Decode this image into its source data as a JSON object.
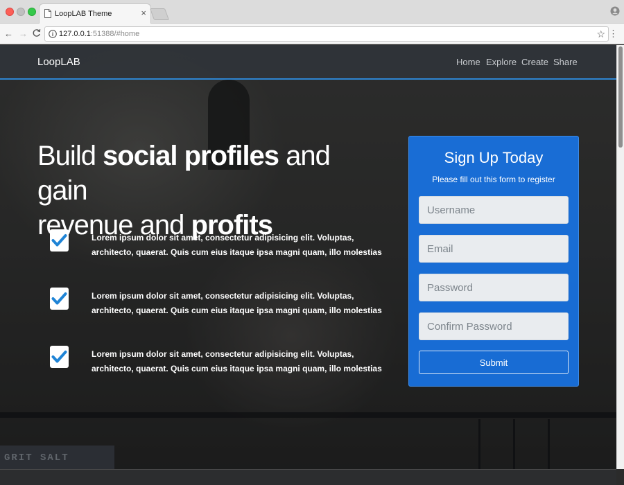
{
  "browser": {
    "tab_title": "LoopLAB Theme",
    "tab_close": "×",
    "url_host": "127.0.0.1",
    "url_rest": ":51388/#home",
    "back": "←",
    "forward": "→",
    "reload": "C",
    "star": "☆",
    "menu": "⋮",
    "icons": [
      "page-icon",
      "info-icon",
      "profile-icon",
      "star-icon",
      "menu-icon"
    ]
  },
  "navbar": {
    "brand": "LoopLAB",
    "links": [
      "Home",
      "Explore",
      "Create",
      "Share"
    ],
    "accent_color": "#2e86d3"
  },
  "hero": {
    "title_parts": [
      "Build ",
      "social profiles",
      " and gain ",
      "revenue and ",
      "profits"
    ]
  },
  "features": [
    {
      "text": "Lorem ipsum dolor sit amet, consectetur adipisicing elit. Voluptas, architecto, quaerat. Quis cum eius itaque ipsa magni quam, illo molestias",
      "icon": "check-icon"
    },
    {
      "text": "Lorem ipsum dolor sit amet, consectetur adipisicing elit. Voluptas, architecto, quaerat. Quis cum eius itaque ipsa magni quam, illo molestias",
      "icon": "check-icon"
    },
    {
      "text": "Lorem ipsum dolor sit amet, consectetur adipisicing elit. Voluptas, architecto, quaerat. Quis cum eius itaque ipsa magni quam, illo molestias",
      "icon": "check-icon"
    }
  ],
  "signup": {
    "title": "Sign Up Today",
    "subtitle": "Please fill out this form to register",
    "fields": [
      {
        "placeholder": "Username",
        "value": ""
      },
      {
        "placeholder": "Email",
        "value": ""
      },
      {
        "placeholder": "Password",
        "value": ""
      },
      {
        "placeholder": "Confirm Password",
        "value": ""
      }
    ],
    "submit": "Submit",
    "card_color": "#1873e4"
  },
  "background": {
    "sign_text": "GRIT SALT"
  }
}
